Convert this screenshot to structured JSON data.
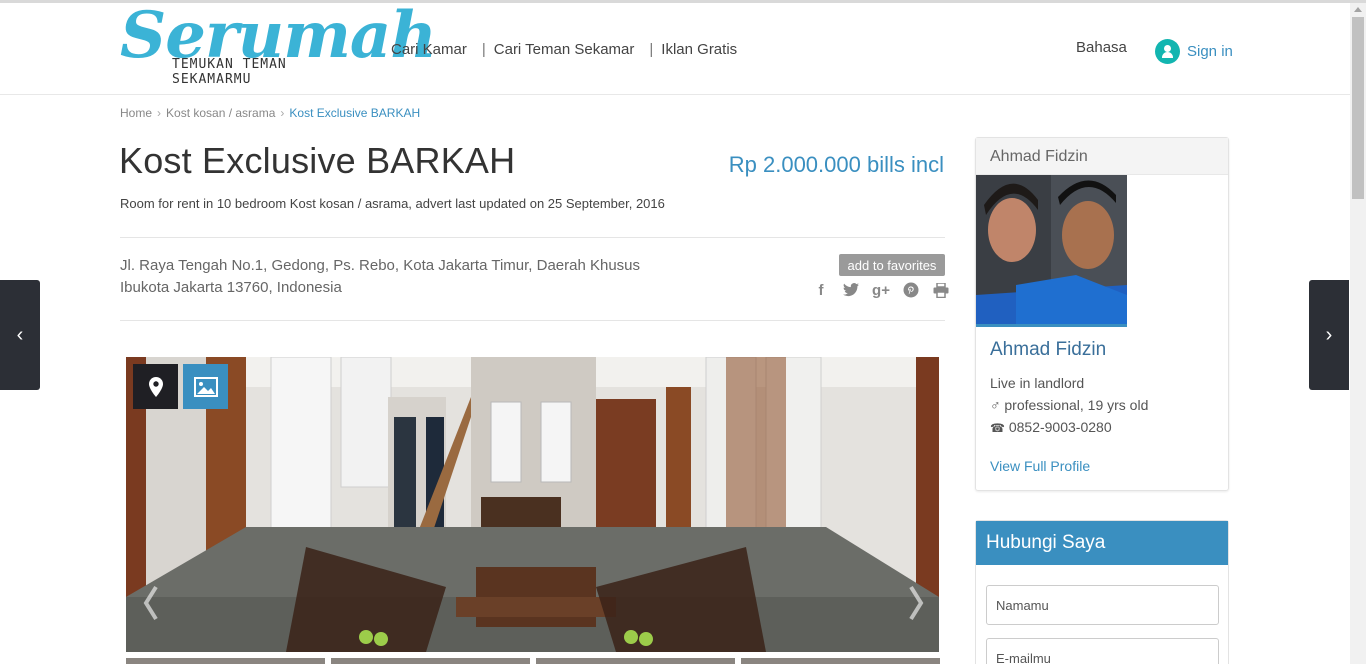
{
  "header": {
    "logo_text": "Serumah",
    "logo_tagline": "TEMUKAN TEMAN SEKAMARMU",
    "nav": [
      "Cari Kamar",
      "Cari Teman Sekamar",
      "Iklan Gratis"
    ],
    "nav_separator": "|",
    "language": "Bahasa",
    "signin": "Sign in"
  },
  "breadcrumb": [
    "Home",
    "Kost kosan / asrama",
    "Kost Exclusive BARKAH"
  ],
  "listing": {
    "title": "Kost Exclusive BARKAH",
    "price": "Rp 2.000.000 bills incl",
    "description": "Room for rent in 10 bedroom Kost kosan / asrama, advert last updated on 25 September, 2016",
    "address": "Jl. Raya Tengah No.1, Gedong, Ps. Rebo, Kota Jakarta Timur, Daerah Khusus Ibukota Jakarta 13760, Indonesia",
    "favorite_label": "add to favorites",
    "share_icons": [
      "facebook-icon",
      "twitter-icon",
      "google-plus-icon",
      "pinterest-icon",
      "print-icon"
    ]
  },
  "profile": {
    "header_name": "Ahmad Fidzin",
    "name": "Ahmad Fidzin",
    "lives": "Live in landlord",
    "occupation": "♂ professional, 19 yrs old",
    "phone": "0852-9003-0280",
    "view_link": "View Full Profile"
  },
  "contact": {
    "title": "Hubungi Saya",
    "name_placeholder": "Namamu",
    "email_placeholder": "E-mailmu"
  },
  "colors": {
    "brand": "#3bb3d6",
    "link": "#3a8fc0",
    "dark_button": "#1f1f24"
  }
}
